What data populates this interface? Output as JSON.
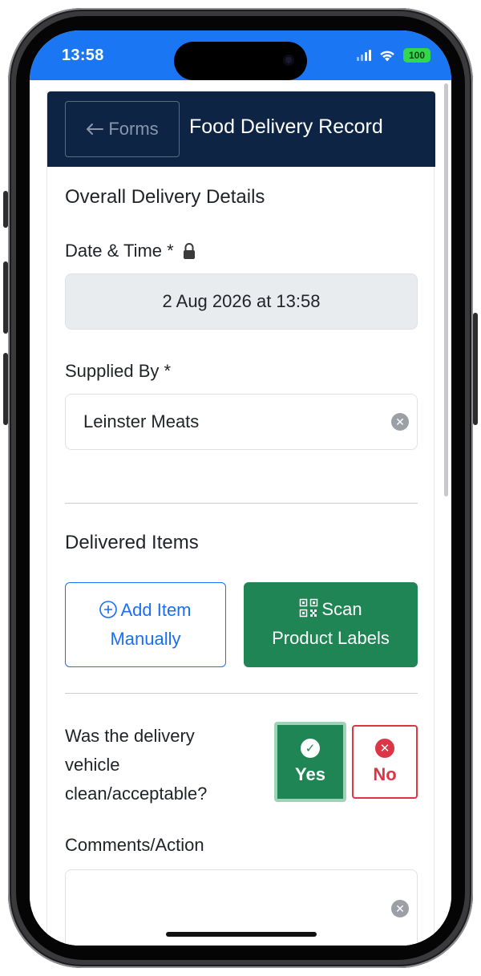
{
  "status_bar": {
    "time": "13:58",
    "battery": "100",
    "signal_icon": "cellular-signal-icon",
    "wifi_icon": "wifi-icon",
    "bar_color": "#1a76f2"
  },
  "header": {
    "back_label": "Forms",
    "back_icon": "arrow-left-icon",
    "title": "Food Delivery Record",
    "bg_color": "#0d2445"
  },
  "overall": {
    "section_title": "Overall Delivery Details",
    "datetime_label": "Date & Time *",
    "lock_icon": "lock-icon",
    "datetime_value": "2 Aug 2026 at 13:58",
    "supplier_label": "Supplied By *",
    "supplier_value": "Leinster Meats"
  },
  "items": {
    "section_title": "Delivered Items",
    "add_label_line1": "Add Item",
    "add_label_line2": "Manually",
    "scan_label_line1": "Scan",
    "scan_label_line2": "Product Labels"
  },
  "vehicle_check": {
    "question": "Was the delivery vehicle clean/acceptable?",
    "yes_label": "Yes",
    "no_label": "No",
    "selected": "Yes",
    "yes_color": "#1f8554",
    "no_color": "#dc3545"
  },
  "comments": {
    "label": "Comments/Action",
    "value": ""
  }
}
